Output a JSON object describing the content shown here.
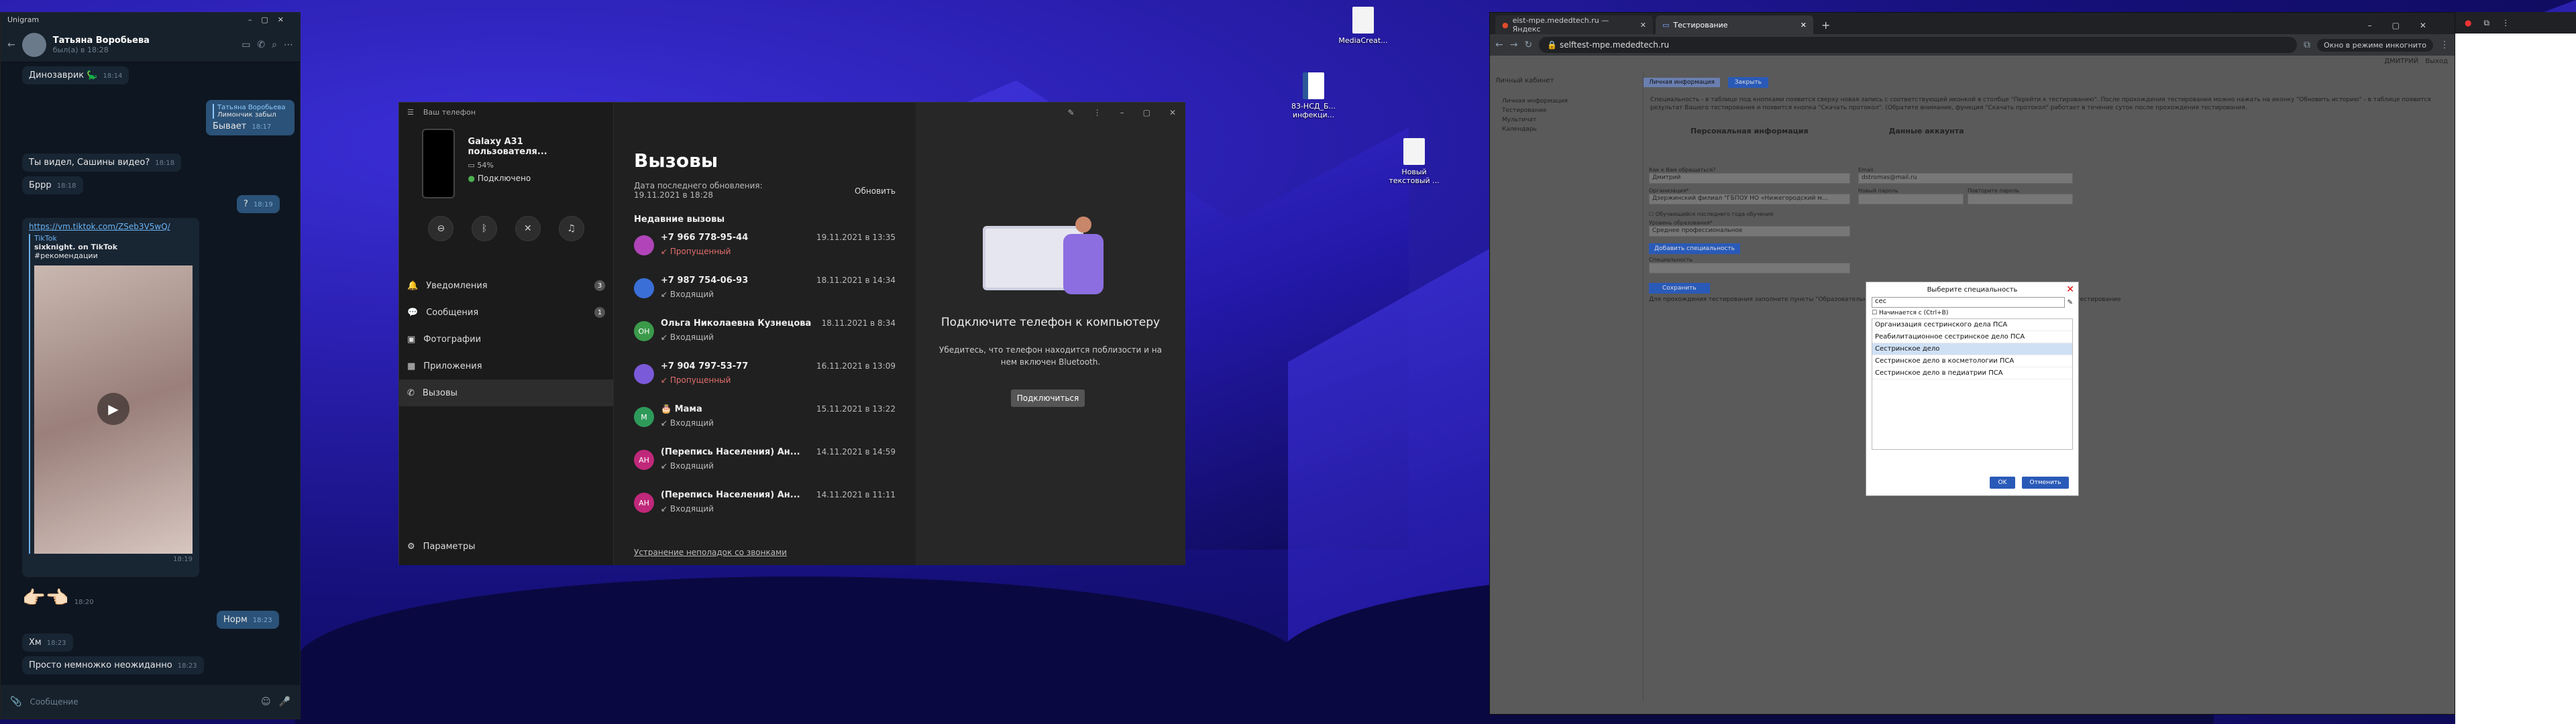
{
  "telegram": {
    "app_title": "Unigram",
    "contact_name": "Татьяна Воробьева",
    "contact_status": "был(а) в 18:28",
    "messages": [
      {
        "dir": "in",
        "text": "Динозаврик 🦕",
        "time": "18:14"
      },
      {
        "dir": "out",
        "reply_name": "Татьяна Воробьева",
        "reply_text": "Лимончик забыл",
        "text": "Бывает",
        "time": "18:17"
      },
      {
        "dir": "in",
        "text": "Ты видел, Сашины видео?",
        "time": "18:18"
      },
      {
        "dir": "in",
        "text": "Бррр",
        "time": "18:18"
      },
      {
        "dir": "out",
        "text": "?",
        "time": "18:19"
      },
      {
        "dir": "in",
        "link": "https://vm.tiktok.com/ZSeb3V5wQ/",
        "site": "TikTok",
        "link_title": "sixknight. on TikTok",
        "link_desc": "#рекомендации",
        "time": "18:19"
      },
      {
        "dir": "in",
        "text": "👉🏻👈🏻",
        "time": "18:20"
      },
      {
        "dir": "out",
        "text": "Норм",
        "time": "18:23"
      },
      {
        "dir": "in",
        "text": "Хм",
        "time": "18:23"
      },
      {
        "dir": "in",
        "text": "Просто немножко неожиданно",
        "time": "18:23"
      }
    ],
    "composer_placeholder": "Сообщение"
  },
  "phone_link": {
    "app_title": "Ваш телефон",
    "device_name": "Galaxy A31 пользователя...",
    "battery": "54%",
    "connection": "Подключено",
    "nav": [
      {
        "label": "Уведомления",
        "badge": "3",
        "icon": "bell-icon"
      },
      {
        "label": "Сообщения",
        "badge": "1",
        "icon": "message-icon"
      },
      {
        "label": "Фотографии",
        "badge": "",
        "icon": "photo-icon"
      },
      {
        "label": "Приложения",
        "badge": "",
        "icon": "apps-icon"
      },
      {
        "label": "Вызовы",
        "badge": "",
        "icon": "phone-icon"
      }
    ],
    "settings": "Параметры",
    "calls_title": "Вызовы",
    "updated": "Дата последнего обновления: 19.11.2021 в 18:28",
    "refresh": "Обновить",
    "recent": "Недавние вызовы",
    "calls": [
      {
        "name": "+7 966 778-95-44",
        "kind": "Пропущенный",
        "date": "19.11.2021 в 13:35",
        "initials": "",
        "color": "#b044b8",
        "missed": true
      },
      {
        "name": "+7 987 754-06-93",
        "kind": "Входящий",
        "date": "18.11.2021 в 14:34",
        "initials": "",
        "color": "#3a6fd8",
        "missed": false
      },
      {
        "name": "Ольга Николаевна Кузнецова",
        "kind": "Входящий",
        "date": "18.11.2021 в 8:34",
        "initials": "ОН",
        "color": "#3a9a4a",
        "missed": false
      },
      {
        "name": "+7 904 797-53-77",
        "kind": "Пропущенный",
        "date": "16.11.2021 в 13:09",
        "initials": "",
        "color": "#7a5ad8",
        "missed": true
      },
      {
        "name": "🎂 Мама",
        "kind": "Входящий",
        "date": "15.11.2021 в 13:22",
        "initials": "М",
        "color": "#2e9a5a",
        "missed": false
      },
      {
        "name": "(Перепись Населения) Ан...",
        "kind": "Входящий",
        "date": "14.11.2021 в 14:59",
        "initials": "АН",
        "color": "#c0287a",
        "missed": false
      },
      {
        "name": "(Перепись Населения) Ан...",
        "kind": "Входящий",
        "date": "14.11.2021 в 11:11",
        "initials": "АН",
        "color": "#c0287a",
        "missed": false
      }
    ],
    "troubleshoot": "Устранение неполадок со звонками",
    "connect_title": "Подключите телефон к компьютеру",
    "connect_desc": "Убедитесь, что телефон находится поблизости и на нем включен Bluetooth.",
    "connect_button": "Подключиться"
  },
  "browser": {
    "tabs": [
      {
        "label": "eist-mpe.mededtech.ru — Яндекс",
        "active": false
      },
      {
        "label": "Тестирование",
        "active": true
      }
    ],
    "url": "selftest-mpe.mededtech.ru",
    "incognito": "Окно в режиме инкогнито",
    "user": "ДМИТРИЙ",
    "logout": "Выход",
    "cabinet": "Личный кабинет",
    "page_tab": "Личная информация",
    "sidebar": [
      "Личная информация",
      "Тестирование",
      "Мультичат",
      "Календарь"
    ],
    "open_btn": "Закрыть",
    "notice": "Специальность - в таблице под кнопками появится сверху новая запись с соответствующей иконкой в столбце \"Перейти к тестированию\". После прохождения тестирования можно нажать на иконку \"Обновить историю\" - в таблице появится результат Вашего тестирования и появится кнопка \"Скачать протокол\". (Обратите внимание, функция \"Скачать протокол\" работает в течение суток после прохождения тестирования.",
    "personal_title": "Персональная информация",
    "account_title": "Данные аккаунта",
    "name_label": "Как к Вам обращаться?",
    "name_value": "Дмитрий",
    "email_label": "Email",
    "email_value": "dstromas@mail.ru",
    "org_label": "Организация*",
    "org_value": "Дзержинский филиал \"ГБПОУ НО «Нижегородский м...",
    "newpass_label": "Новый пароль",
    "repeat_label": "Повторите пароль",
    "student_label": "Обучающийся последнего года обучения",
    "level_label": "Уровень образования*",
    "level_value": "Среднее профессиональное",
    "add_spec": "Добавить специальность",
    "spec_label": "Специальность",
    "save_btn": "Сохранить",
    "footer_note": "Для прохождения тестирования заполните пункты \"Образовательная ...\" ...ажите специальность, по которым Вы хотите проходить тестирование",
    "modal": {
      "title": "Выберите специальность",
      "search_value": "сес",
      "starts_with": "Начинается с (Ctrl+B)",
      "options": [
        "Организация сестринского дела ПСА",
        "Реабилитационное сестринское дело ПСА",
        "Сестринское дело",
        "Сестринское дело в косметологии ПСА",
        "Сестринское дело в педиатрии ПСА"
      ],
      "selected_index": 2,
      "ok": "OK",
      "cancel": "Отменить"
    }
  },
  "desktop_icons": [
    {
      "label": "MediaCreat...",
      "type": "file"
    },
    {
      "label": "83-НСД_Б... инфекци...",
      "type": "word"
    },
    {
      "label": "Новый текстовый ...",
      "type": "file"
    }
  ]
}
